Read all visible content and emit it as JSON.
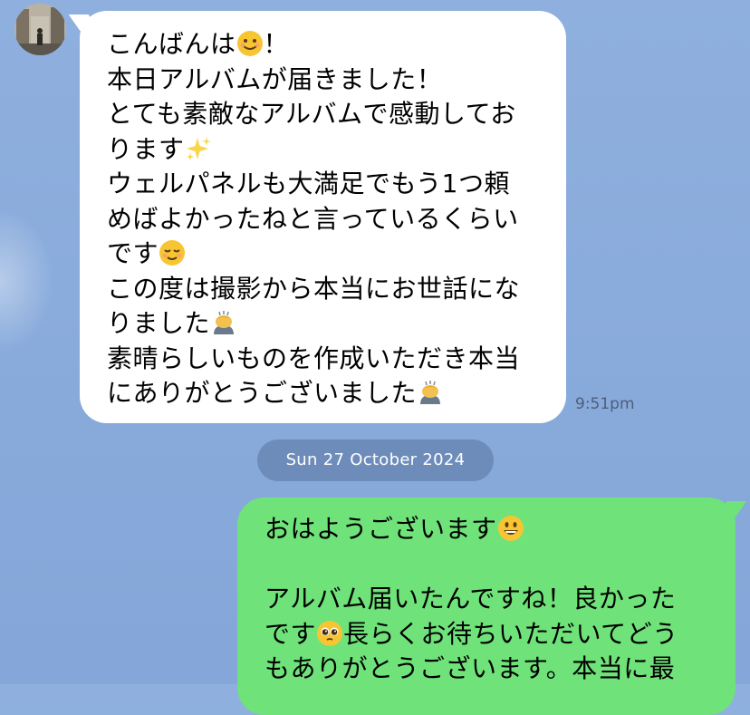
{
  "incoming": {
    "lines": [
      {
        "text": "こんばんは",
        "emoji": "smiling-face-icon",
        "after": "！"
      },
      {
        "text": "本日アルバムが届きました！"
      },
      {
        "text": "とても素敵なアルバムで感動してお"
      },
      {
        "text": "ります",
        "emoji": "sparkles-icon"
      },
      {
        "text": "ウェルパネルも大満足でもう1つ頼"
      },
      {
        "text": "めばよかったねと言っているくらい"
      },
      {
        "text": "です",
        "emoji": "relieved-face-icon"
      },
      {
        "text": "この度は撮影から本当にお世話にな"
      },
      {
        "text": "りました",
        "emoji": "bowing-person-icon"
      },
      {
        "text": "素晴らしいものを作成いただき本当"
      },
      {
        "text": "にありがとうございました",
        "emoji": "bowing-person-icon"
      }
    ],
    "time": "9:51pm"
  },
  "date_separator": "Sun 27 October 2024",
  "outgoing": {
    "lines": [
      {
        "text": "おはようございます",
        "emoji": "grinning-face-icon"
      },
      {
        "text": ""
      },
      {
        "text": "アルバム届いたんですね！良かった"
      },
      {
        "text": "です",
        "emoji": "pleading-face-icon",
        "after": "長らくお待ちいただいてどう"
      },
      {
        "text": "もありがとうございます。本当に最"
      }
    ]
  },
  "colors": {
    "background": "#8fb0de",
    "incoming_bubble": "#ffffff",
    "outgoing_bubble": "#6fe27a",
    "time_text": "#4d5e7a"
  }
}
